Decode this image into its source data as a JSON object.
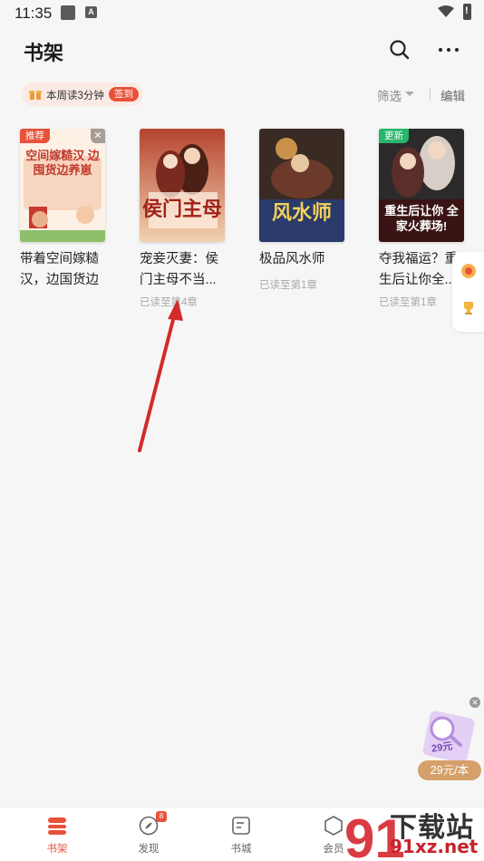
{
  "status_bar": {
    "time": "11:35",
    "a_badge": "A"
  },
  "header": {
    "title": "书架"
  },
  "reading": {
    "text": "本周读3分钟",
    "signin_label": "签到"
  },
  "toolbar": {
    "filter_label": "筛选",
    "edit_label": "编辑"
  },
  "books": [
    {
      "tag": "推荐",
      "tag_color": "#e8513a",
      "title": "带着空间嫁糙汉，边国货边养",
      "progress": "",
      "cover_text": "空间嫁糙汉 边囤货边养崽"
    },
    {
      "tag": "",
      "title": "宠妾灭妻：侯门主母不当...",
      "progress": "已读至第4章",
      "cover_text": "侯门主母"
    },
    {
      "tag": "",
      "title": "极品风水师",
      "progress": "已读至第1章",
      "cover_text": "风水师"
    },
    {
      "tag": "更新",
      "tag_color": "#27b56a",
      "title": "夺我福运？重生后让你全...",
      "progress": "已读至第1章",
      "cover_text": "重生后让你 全家火葬场!"
    }
  ],
  "promo": {
    "price": "29元/本",
    "badge_text": "29元"
  },
  "bottom_nav": [
    {
      "label": "书架",
      "icon": "bookshelf-icon",
      "active": true
    },
    {
      "label": "发现",
      "icon": "compass-icon",
      "badge": "8"
    },
    {
      "label": "书城",
      "icon": "book-store-icon"
    },
    {
      "label": "会员",
      "icon": "vip-icon"
    }
  ],
  "watermark": {
    "text_cn": "下载站",
    "text_en": "91xz.net",
    "logo": "91"
  },
  "colors": {
    "accent": "#e8513a",
    "green_tag": "#27b56a",
    "gold": "#d5a06a",
    "arrow": "#d42a2a"
  }
}
